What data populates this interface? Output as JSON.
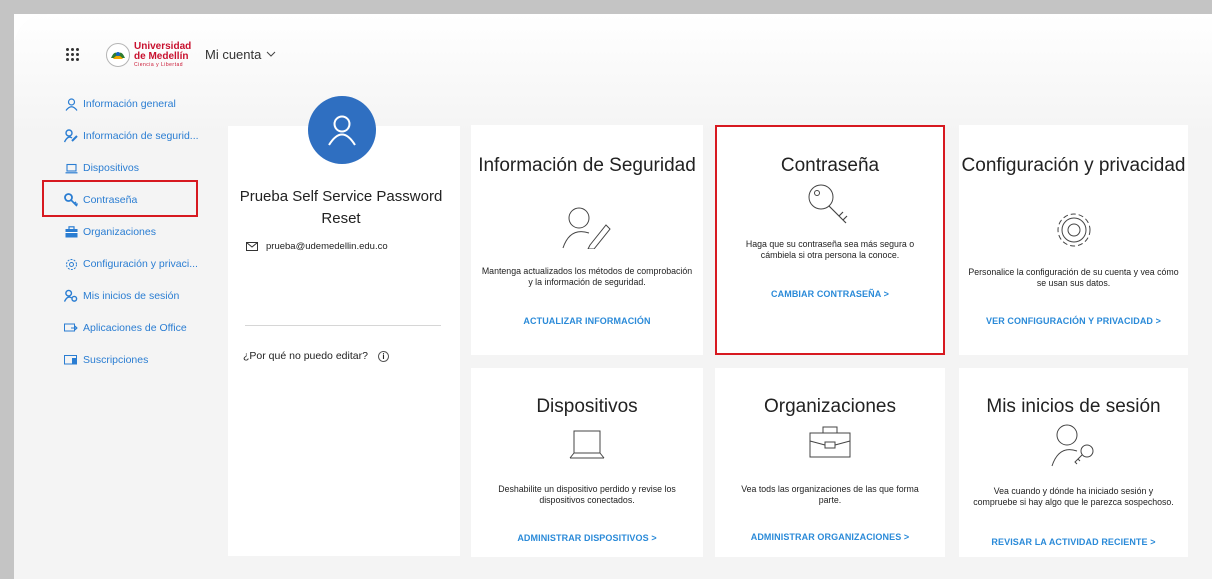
{
  "header": {
    "logo": {
      "line1": "Universidad",
      "line2": "de Medellín",
      "tagline": "Ciencia y Libertad"
    },
    "account_label": "Mi cuenta"
  },
  "sidebar": {
    "items": [
      {
        "label": "Información general",
        "icon": "person-icon"
      },
      {
        "label": "Información de segurid...",
        "icon": "security-info-icon"
      },
      {
        "label": "Dispositivos",
        "icon": "laptop-icon"
      },
      {
        "label": "Contraseña",
        "icon": "key-icon"
      },
      {
        "label": "Organizaciones",
        "icon": "briefcase-icon"
      },
      {
        "label": "Configuración y privaci...",
        "icon": "gear-icon"
      },
      {
        "label": "Mis inicios de sesión",
        "icon": "sign-ins-icon"
      },
      {
        "label": "Aplicaciones de Office",
        "icon": "apps-icon"
      },
      {
        "label": "Suscripciones",
        "icon": "subscriptions-icon"
      }
    ]
  },
  "profile": {
    "name": "Prueba Self Service Password Reset",
    "email": "prueba@udemedellin.edu.co",
    "why_cant_edit": "¿Por qué no puedo editar?",
    "info_glyph": "i"
  },
  "tiles": {
    "security": {
      "title": "Información de Seguridad",
      "description": "Mantenga actualizados los métodos de comprobación y la información de seguridad.",
      "link": "ACTUALIZAR INFORMACIÓN"
    },
    "password": {
      "title": "Contraseña",
      "description": "Haga que su contraseña sea más segura o cámbiela si otra persona la conoce.",
      "link": "CAMBIAR CONTRASEÑA >"
    },
    "settings": {
      "title": "Configuración y privacidad",
      "description": "Personalice la configuración de su cuenta y vea cómo se usan sus datos.",
      "link": "VER CONFIGURACIÓN Y PRIVACIDAD >"
    },
    "devices": {
      "title": "Dispositivos",
      "description": "Deshabilite un dispositivo perdido y revise los dispositivos conectados.",
      "link": "ADMINISTRAR DISPOSITIVOS >"
    },
    "organizations": {
      "title": "Organizaciones",
      "description": "Vea tods las organizaciones de las que forma parte.",
      "link": "ADMINISTRAR ORGANIZACIONES >"
    },
    "signins": {
      "title": "Mis inicios de sesión",
      "description": "Vea cuando y dónde ha iniciado sesión y compruebe si hay algo que le parezca sospechoso.",
      "link": "REVISAR LA ACTIVIDAD RECIENTE >"
    }
  },
  "colors": {
    "accent": "#2a7dd2",
    "highlight": "#d71920",
    "avatar": "#2f6fc1",
    "logo_red": "#c8102e"
  }
}
